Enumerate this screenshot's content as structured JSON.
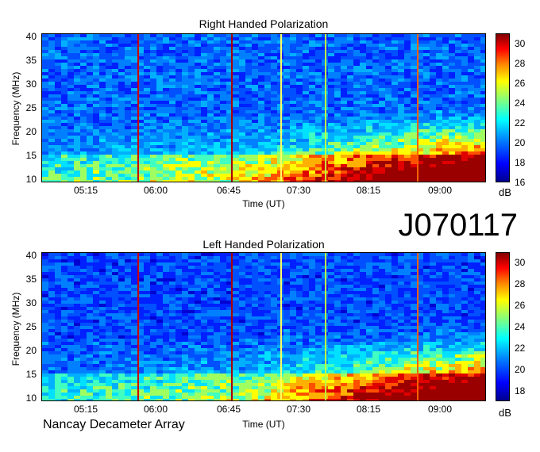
{
  "observation_id": "J070117",
  "footer": "Nancay Decameter Array",
  "chart_data": [
    {
      "type": "heatmap",
      "title": "Right Handed Polarization",
      "xlabel": "Time (UT)",
      "ylabel": "Frequency (MHz)",
      "x_ticks": [
        "05:15",
        "06:00",
        "06:45",
        "07:30",
        "08:15",
        "09:00"
      ],
      "y_ticks": [
        10,
        15,
        20,
        25,
        30,
        35,
        40
      ],
      "ylim": [
        10,
        40
      ],
      "colorbar": {
        "label": "dB",
        "ticks": [
          16,
          18,
          20,
          22,
          24,
          26,
          28,
          30
        ],
        "range": [
          16,
          31
        ]
      }
    },
    {
      "type": "heatmap",
      "title": "Left Handed Polarization",
      "xlabel": "Time (UT)",
      "ylabel": "Frequency (MHz)",
      "x_ticks": [
        "05:15",
        "06:00",
        "06:45",
        "07:30",
        "08:15",
        "09:00"
      ],
      "y_ticks": [
        10,
        15,
        20,
        25,
        30,
        35,
        40
      ],
      "ylim": [
        10,
        40
      ],
      "colorbar": {
        "label": "dB",
        "ticks": [
          18,
          20,
          22,
          24,
          26,
          28,
          30
        ],
        "range": [
          17,
          31
        ]
      }
    }
  ]
}
